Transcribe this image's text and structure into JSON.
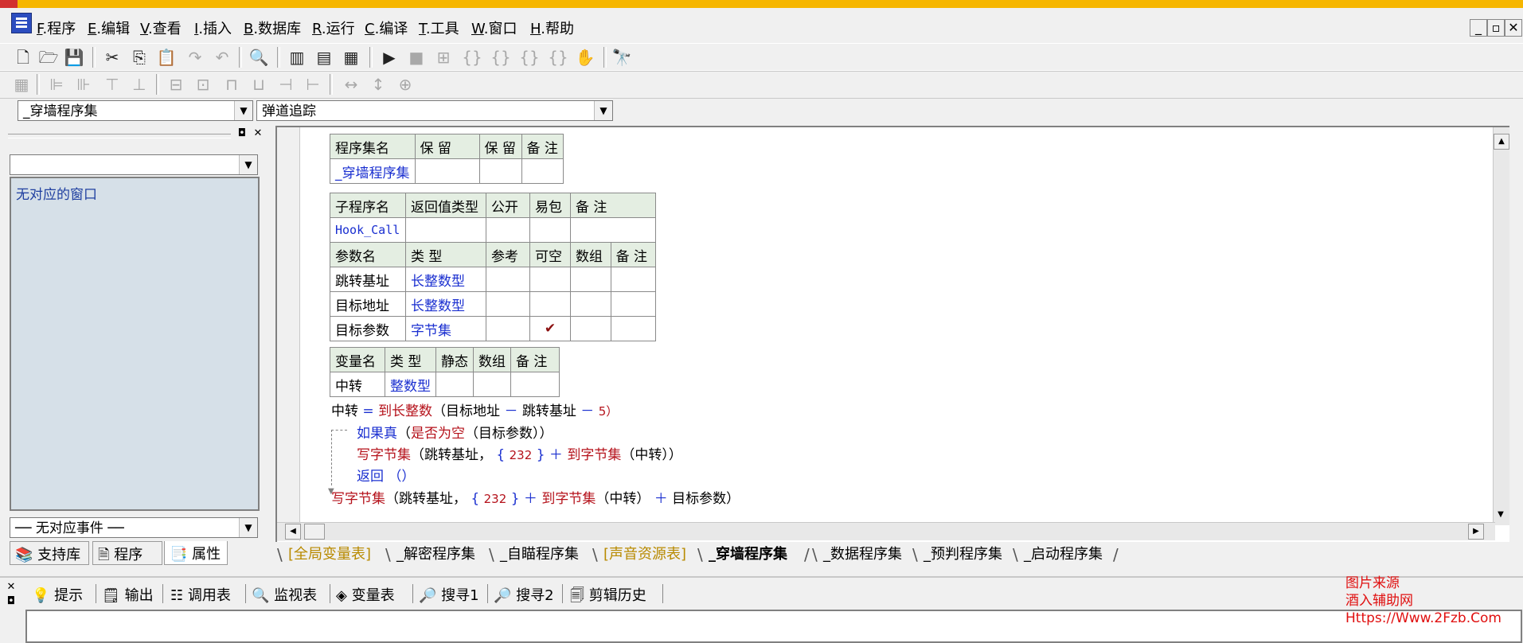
{
  "menu": {
    "items": [
      {
        "key": "F",
        "label": "程序"
      },
      {
        "key": "E",
        "label": "编辑"
      },
      {
        "key": "V",
        "label": "查看"
      },
      {
        "key": "I",
        "label": "插入"
      },
      {
        "key": "B",
        "label": "数据库"
      },
      {
        "key": "R",
        "label": "运行"
      },
      {
        "key": "C",
        "label": "编译"
      },
      {
        "key": "T",
        "label": "工具"
      },
      {
        "key": "W",
        "label": "窗口"
      },
      {
        "key": "H",
        "label": "帮助"
      }
    ]
  },
  "toolbar": {
    "assembly_select": "_穿墙程序集",
    "sub_select": "弹道追踪"
  },
  "left_panel": {
    "window_list_text": "无对应的窗口",
    "event_select": "── 无对应事件 ──",
    "tabs": [
      "支持库",
      "程序",
      "属性"
    ]
  },
  "assembly_table": {
    "headers": [
      "程序集名",
      "保 留",
      "保 留",
      "备 注"
    ],
    "row": [
      "_穿墙程序集",
      "",
      "",
      ""
    ]
  },
  "sub_table": {
    "headers": [
      "子程序名",
      "返回值类型",
      "公开",
      "易包",
      "备 注"
    ],
    "row": [
      "Hook_Call",
      "",
      "",
      "",
      ""
    ],
    "param_headers": [
      "参数名",
      "类 型",
      "参考",
      "可空",
      "数组",
      "备 注"
    ],
    "params": [
      {
        "name": "跳转基址",
        "type": "长整数型",
        "ref": "",
        "nullable": "",
        "array": "",
        "note": ""
      },
      {
        "name": "目标地址",
        "type": "长整数型",
        "ref": "",
        "nullable": "",
        "array": "",
        "note": ""
      },
      {
        "name": "目标参数",
        "type": "字节集",
        "ref": "",
        "nullable": "✔",
        "array": "",
        "note": ""
      }
    ]
  },
  "var_table": {
    "headers": [
      "变量名",
      "类 型",
      "静态",
      "数组",
      "备 注"
    ],
    "row": [
      "中转",
      "整数型",
      "",
      "",
      ""
    ]
  },
  "code": {
    "l1": {
      "a": "中转",
      "b": "=",
      "c": "到长整数",
      "d": "（目标地址",
      "e": "－",
      "f": "跳转基址",
      "g": "－",
      "h": "5）"
    },
    "l2": {
      "a": "如果真",
      "b": "（",
      "c": "是否为空",
      "d": "（目标参数））"
    },
    "l3": {
      "a": "写字节集",
      "b": "（跳转基址，",
      "c": "{",
      "d": "232",
      "e": "}",
      "f": "＋",
      "g": "到字节集",
      "h": "（中转））"
    },
    "l4": {
      "a": "返回",
      "b": "（）"
    },
    "l5": {
      "a": "写字节集",
      "b": "（跳转基址，",
      "c": "{",
      "d": "232",
      "e": "}",
      "f": "＋",
      "g": "到字节集",
      "h": "（中转）",
      "i": "＋",
      "j": "目标参数）"
    }
  },
  "file_tabs": [
    {
      "label": "[全局变量表]",
      "style": "gold"
    },
    {
      "label": "_解密程序集",
      "style": ""
    },
    {
      "label": "_自瞄程序集",
      "style": ""
    },
    {
      "label": "[声音资源表]",
      "style": "gold"
    },
    {
      "label": "_穿墙程序集",
      "style": "active"
    },
    {
      "label": "_数据程序集",
      "style": ""
    },
    {
      "label": "_预判程序集",
      "style": ""
    },
    {
      "label": "_启动程序集",
      "style": ""
    }
  ],
  "output_tabs": [
    "提示",
    "输出",
    "调用表",
    "监视表",
    "变量表",
    "搜寻1",
    "搜寻2",
    "剪辑历史"
  ],
  "watermark": {
    "line1": "图片来源",
    "line2": "酒入辅助网",
    "line3": "Https://Www.2Fzb.Com"
  }
}
